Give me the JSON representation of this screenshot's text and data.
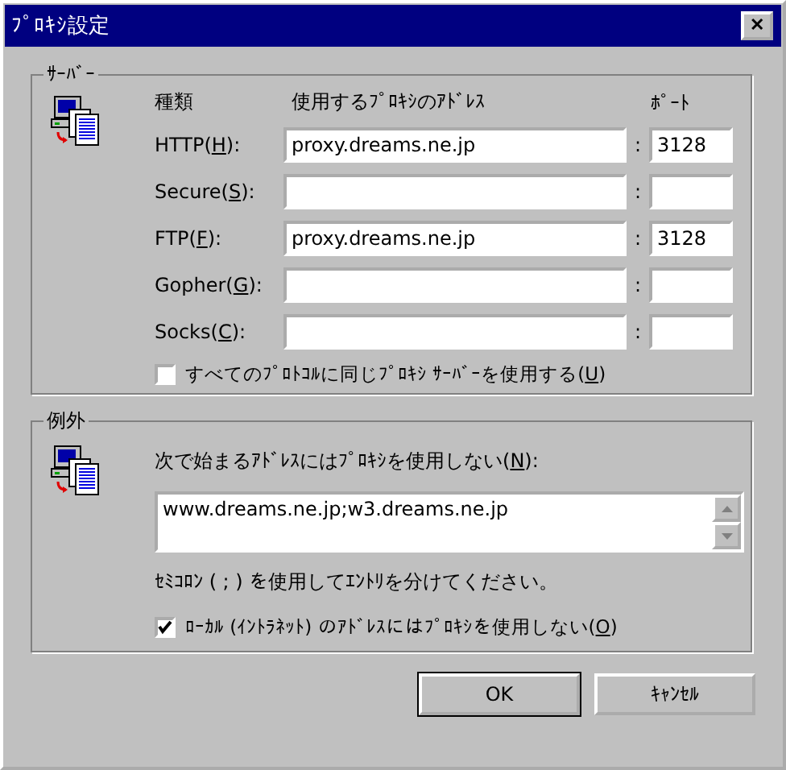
{
  "window": {
    "title": "ﾌﾟﾛｷｼ設定",
    "close": "✕"
  },
  "servers": {
    "title": "ｻｰﾊﾞｰ",
    "headers": {
      "type": "種類",
      "address": "使用するﾌﾟﾛｷｼのｱﾄﾞﾚｽ",
      "port": "ﾎﾟｰﾄ"
    },
    "rows": [
      {
        "label": "HTTP(",
        "mnemonic": "H",
        "label_end": "):",
        "address": "proxy.dreams.ne.jp",
        "separator": ":",
        "port": "3128"
      },
      {
        "label": "Secure(",
        "mnemonic": "S",
        "label_end": "):",
        "separator": ":"
      },
      {
        "label": "FTP(",
        "mnemonic": "F",
        "label_end": "):",
        "address": "proxy.dreams.ne.jp",
        "separator": ":",
        "port": "3128"
      },
      {
        "label": "Gopher(",
        "mnemonic": "G",
        "label_end": "):",
        "separator": ":"
      },
      {
        "label": "Socks(",
        "mnemonic": "C",
        "label_end": "):",
        "separator": ":"
      }
    ],
    "same_proxy": {
      "label": "すべてのﾌﾟﾛﾄｺﾙに同じﾌﾟﾛｷｼ ｻｰﾊﾞｰを使用する(",
      "mnemonic": "U",
      "label_end": ")",
      "checked": false
    }
  },
  "exceptions": {
    "title": "例外",
    "prompt": {
      "label": "次で始まるｱﾄﾞﾚｽにはﾌﾟﾛｷｼを使用しない(",
      "mnemonic": "N",
      "label_end": "):"
    },
    "value": "www.dreams.ne.jp;w3.dreams.ne.jp",
    "hint": "ｾﾐｺﾛﾝ ( ; ) を使用してｴﾝﾄﾘを分けてください。",
    "bypass_local": {
      "label": "ﾛｰｶﾙ (ｲﾝﾄﾗﾈｯﾄ) のｱﾄﾞﾚｽにはﾌﾟﾛｷｼを使用しない(",
      "mnemonic": "O",
      "label_end": ")",
      "checked": true
    }
  },
  "buttons": [
    {
      "label": "OK",
      "default": true
    },
    {
      "label": "ｷｬﾝｾﾙ",
      "default": false
    }
  ]
}
